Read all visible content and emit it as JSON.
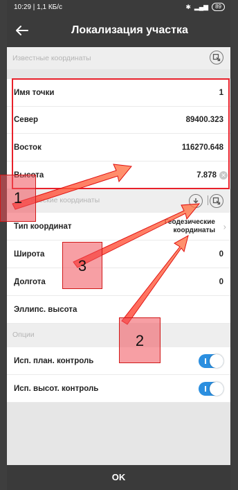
{
  "statusbar": {
    "time": "10:29 | 1,1 КБ/с",
    "battery": "89"
  },
  "header": {
    "title": "Локализация участка"
  },
  "known": {
    "section_label": "Известные координаты",
    "rows": [
      {
        "label": "Имя точки",
        "value": "1"
      },
      {
        "label": "Север",
        "value": "89400.323"
      },
      {
        "label": "Восток",
        "value": "116270.648"
      },
      {
        "label": "Высота",
        "value": "7.878"
      }
    ]
  },
  "measured": {
    "section_label": "...ические координаты",
    "coord_type_label": "Тип координат",
    "coord_type_value_line1": "Геодезические",
    "coord_type_value_line2": "координаты",
    "rows": [
      {
        "label": "Широта",
        "value": "0"
      },
      {
        "label": "Долгота",
        "value": "0"
      },
      {
        "label": "Эллипс. высота",
        "value": ""
      }
    ]
  },
  "options": {
    "section_label": "Опции",
    "rows": [
      {
        "label": "Исп. план. контроль",
        "on": true
      },
      {
        "label": "Исп. высот. контроль",
        "on": true
      }
    ]
  },
  "ok_label": "OK",
  "annotations": [
    "1",
    "2",
    "3"
  ],
  "colors": {
    "accent": "#2b8fe0",
    "annotation": "#e8202a",
    "header": "#3b3b3b"
  }
}
